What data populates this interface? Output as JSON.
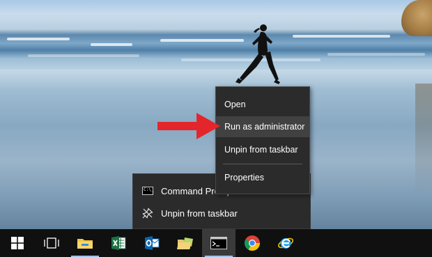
{
  "context_menu": {
    "items": [
      {
        "label": "Open"
      },
      {
        "label": "Run as administrator",
        "highlighted": true
      },
      {
        "label": "Unpin from taskbar"
      },
      {
        "label": "Properties"
      }
    ]
  },
  "jump_list": {
    "pinned_item": "Command Prompt",
    "unpin_label": "Unpin from taskbar"
  },
  "annotation": {
    "arrow_color": "#e3262b"
  },
  "taskbar": {
    "buttons": [
      {
        "icon": "windows-start-icon"
      },
      {
        "icon": "task-view-icon"
      },
      {
        "icon": "file-explorer-icon"
      },
      {
        "icon": "excel-icon"
      },
      {
        "icon": "outlook-icon"
      },
      {
        "icon": "sticky-folder-icon"
      },
      {
        "icon": "command-prompt-icon",
        "active": true
      },
      {
        "icon": "chrome-icon"
      },
      {
        "icon": "internet-explorer-icon"
      }
    ]
  }
}
